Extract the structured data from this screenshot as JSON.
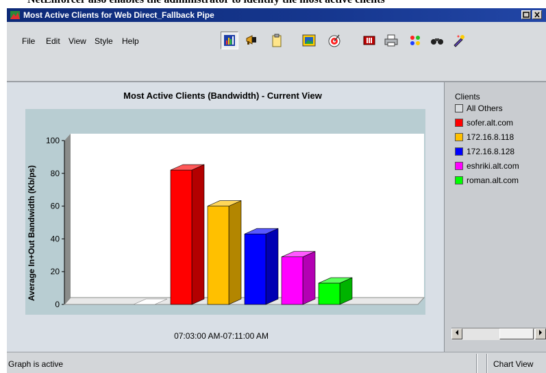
{
  "page_header_fragment": "NetEnforcer also enables the administrator to identify the most active clients",
  "window": {
    "title": "Most Active Clients for Web Direct_Fallback Pipe"
  },
  "menu": [
    "File",
    "Edit",
    "View",
    "Style",
    "Help"
  ],
  "toolbar_icons": [
    "bar-chart-icon",
    "megaphone-icon",
    "clipboard-icon",
    "picture-icon",
    "target-icon",
    "filter-icon",
    "print-icon",
    "palette-icon",
    "binoculars-icon",
    "wizard-icon"
  ],
  "chart_data": {
    "type": "bar",
    "title": "Most Active Clients (Bandwidth) - Current View",
    "ylabel": "Average In+Out Bandwidth (Kb/ps)",
    "xlabel": "07:03:00 AM-07:11:00 AM",
    "ylim": [
      0,
      100
    ],
    "yticks": [
      "100",
      "80",
      "60",
      "40",
      "20",
      "0"
    ],
    "series": [
      {
        "name": "All Others",
        "value": 0,
        "color": "#ffffff"
      },
      {
        "name": "sofer.alt.com",
        "value": 82,
        "color": "#ff0000"
      },
      {
        "name": "172.16.8.118",
        "value": 60,
        "color": "#ffc000"
      },
      {
        "name": "172.16.8.128",
        "value": 43,
        "color": "#0000ff"
      },
      {
        "name": "eshriki.alt.com",
        "value": 29,
        "color": "#ff00ff"
      },
      {
        "name": "roman.alt.com",
        "value": 13,
        "color": "#00ff00"
      }
    ]
  },
  "legend": {
    "title": "Clients"
  },
  "status": {
    "left": "Graph is active",
    "right": "Chart View"
  }
}
